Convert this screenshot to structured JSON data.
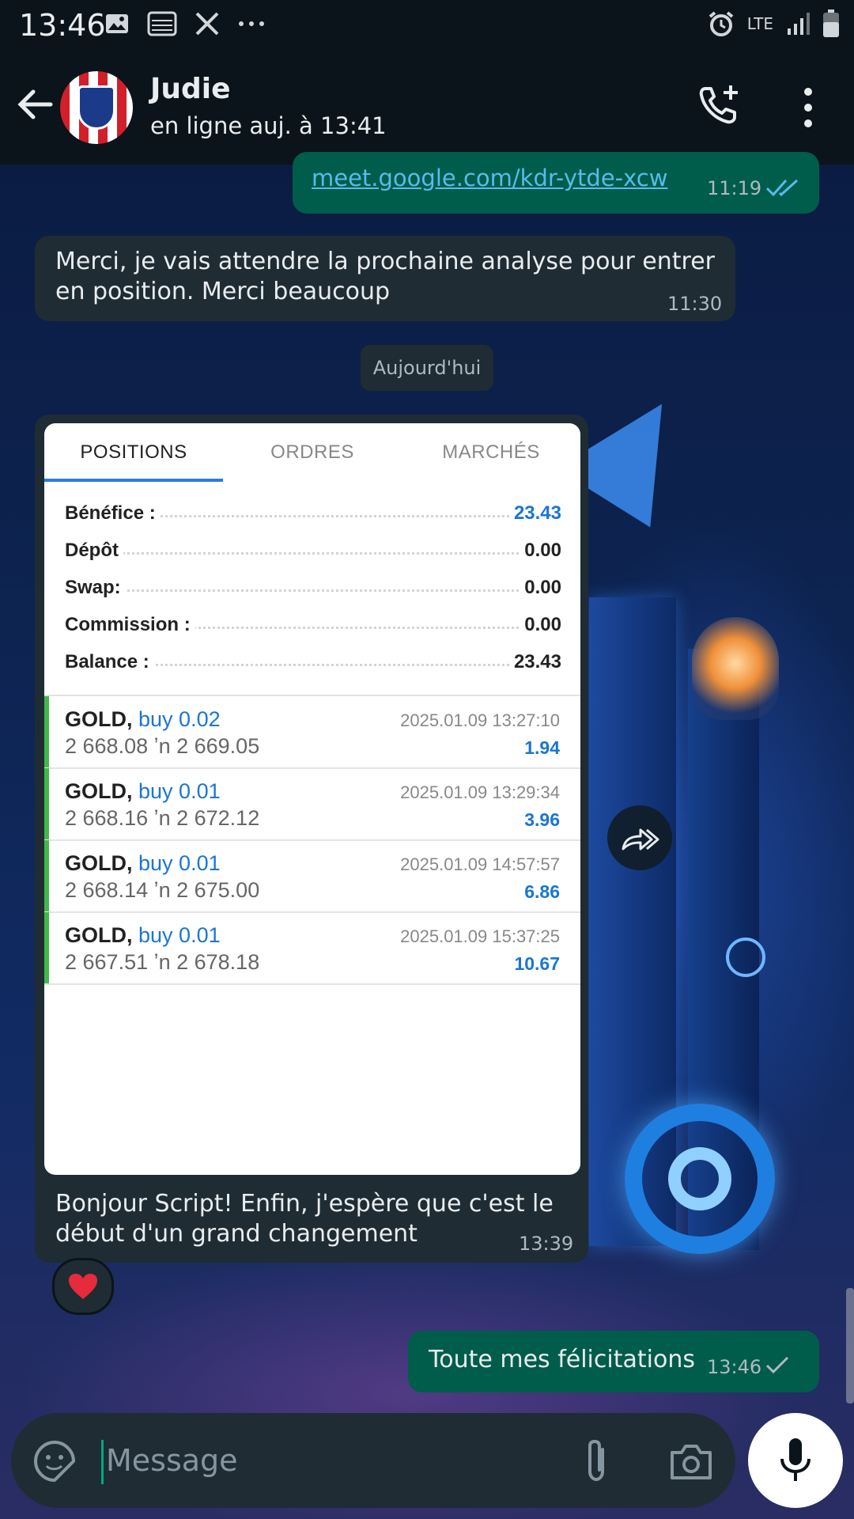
{
  "status_bar": {
    "time": "13:46",
    "left_icons": [
      "image-icon",
      "gallery-icon",
      "x-logo-icon",
      "more-dots-icon"
    ],
    "right_icons": [
      "alarm-icon",
      "lte-icon",
      "signal-icon",
      "battery-icon"
    ],
    "network": "LTE"
  },
  "header": {
    "contact_name": "Judie",
    "status": "en ligne auj. à 13:41"
  },
  "messages": {
    "link_message": {
      "text": "meet.google.com/kdr-ytde-xcw",
      "time": "11:19"
    },
    "merci_message": {
      "line1": "Merci, je vais attendre la prochaine analyse pour entrer",
      "line2": "en position. Merci beaucoup",
      "time": "11:30"
    },
    "date_separator": "Aujourd'hui",
    "image_message": {
      "caption_line1": "Bonjour Script! Enfin, j'espère que c'est le",
      "caption_line2": "début d'un grand changement",
      "time": "13:39",
      "reaction": "❤️"
    },
    "last_message": {
      "text": "Toute mes félicitations",
      "time": "13:46"
    }
  },
  "screenshot": {
    "tabs": [
      "POSITIONS",
      "ORDRES",
      "MARCHÉS"
    ],
    "active_tab": "POSITIONS",
    "summary": [
      {
        "label": "Bénéfice :",
        "value": "23.43"
      },
      {
        "label": "Dépôt",
        "value": "0.00"
      },
      {
        "label": "Swap:",
        "value": "0.00"
      },
      {
        "label": "Commission :",
        "value": "0.00"
      },
      {
        "label": "Balance :",
        "value": "23.43"
      }
    ],
    "positions": [
      {
        "symbol": "GOLD,",
        "side": "buy 0.02",
        "prices": "2 668.08 ʼn  2 669.05",
        "date": "2025.01.09 13:27:10",
        "profit": "1.94"
      },
      {
        "symbol": "GOLD,",
        "side": "buy 0.01",
        "prices": "2 668.16 ʼn  2 672.12",
        "date": "2025.01.09 13:29:34",
        "profit": "3.96"
      },
      {
        "symbol": "GOLD,",
        "side": "buy 0.01",
        "prices": "2 668.14 ʼn  2 675.00",
        "date": "2025.01.09 14:57:57",
        "profit": "6.86"
      },
      {
        "symbol": "GOLD,",
        "side": "buy 0.01",
        "prices": "2 667.51 ʼn  2 678.18",
        "date": "2025.01.09 15:37:25",
        "profit": "10.67"
      }
    ]
  },
  "composer": {
    "placeholder": "Message"
  },
  "colors": {
    "outgoing_bubble": "#005c4b",
    "incoming_bubble": "#1f2c34",
    "header_bg": "#0b141a",
    "link": "#53bdeb",
    "profit_blue": "#1976d2",
    "position_bar": "#43b84a"
  }
}
